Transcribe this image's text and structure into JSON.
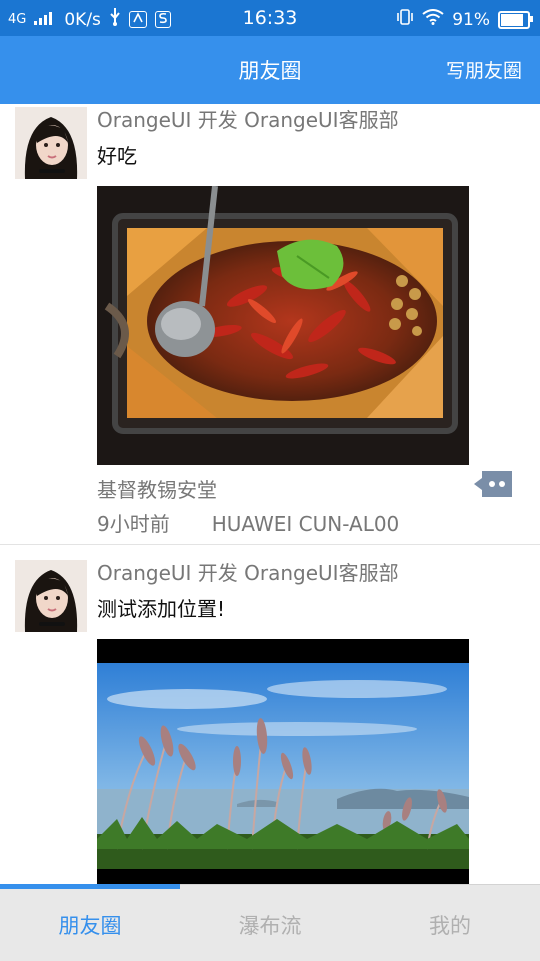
{
  "status_bar": {
    "network": "4G",
    "speed": "0K/s",
    "time": "16:33",
    "battery_text": "91%",
    "battery_level": 0.91
  },
  "header": {
    "title": "朋友圈",
    "action_label": "写朋友圈"
  },
  "posts": [
    {
      "user": "OrangeUI 开发 OrangeUI客服部",
      "text": "好吃",
      "photo_icon": "spicy-fish-dish-photo",
      "location": "基督教锡安堂",
      "time": "9小时前",
      "device": "HUAWEI CUN-AL00",
      "comment_icon": "comment-icon"
    },
    {
      "user": "OrangeUI 开发 OrangeUI客服部",
      "text": "测试添加位置!",
      "photo_icon": "seaside-reeds-photo"
    }
  ],
  "tabs": [
    {
      "label": "朋友圈",
      "active": true
    },
    {
      "label": "瀑布流",
      "active": false
    },
    {
      "label": "我的",
      "active": false
    }
  ],
  "colors": {
    "status_bar_bg": "#1b76d2",
    "header_bg": "#3690ec",
    "accent": "#3690ec",
    "muted_text": "#777777"
  }
}
